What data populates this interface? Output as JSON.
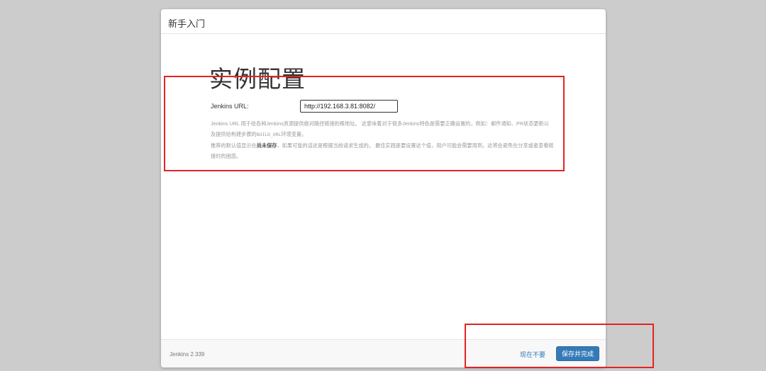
{
  "modal": {
    "title": "新手入门"
  },
  "page": {
    "title": "实例配置"
  },
  "url_field": {
    "label": "Jenkins URL:",
    "value": "http://192.168.3.81:8082/"
  },
  "help": {
    "p1_a": "Jenkins URL 用于给各种Jenkins资源提供绝对路径链接的根地址。 这意味着对于很多Jenkins特色是需要正确设置的，例如：邮件通知、PR状态更新以及提供给构建步骤的",
    "p1_code": "BUILD_URL",
    "p1_b": "环境变量。",
    "p2_a": "推荐的默认值显示在",
    "p2_bold": "尚未保存",
    "p2_b": "，如果可能的话这是根据当前请求生成的。 最佳实践是要设置这个值，用户可能会需要用到。这将会避免在分享或者查看链接时的困惑。"
  },
  "footer": {
    "version": "Jenkins 2.339",
    "skip_label": "现在不要",
    "save_label": "保存并完成"
  },
  "colors": {
    "primary": "#337ab7",
    "annotation": "#e52222",
    "backdrop": "#cccccc"
  }
}
